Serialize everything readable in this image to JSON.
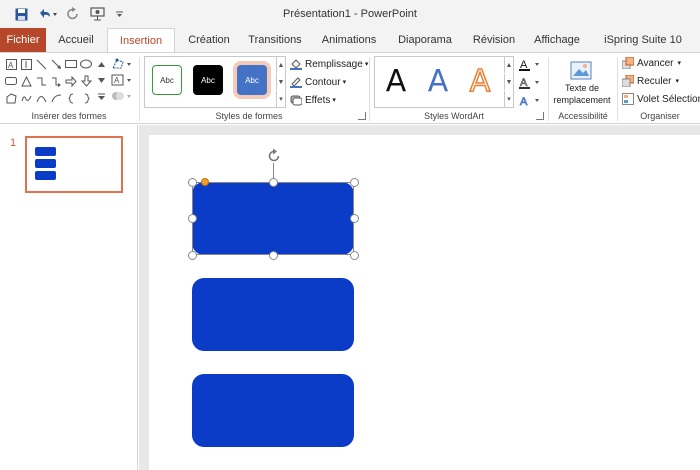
{
  "window": {
    "title": "Présentation1  -  PowerPoint"
  },
  "quick_access": {
    "save_icon": "save-icon",
    "undo_icon": "undo-icon",
    "redo_icon": "redo-icon",
    "present_icon": "present-from-start-icon",
    "customize_icon": "customize-toolbar-icon"
  },
  "tabs": [
    {
      "label": "Fichier"
    },
    {
      "label": "Accueil"
    },
    {
      "label": "Insertion"
    },
    {
      "label": "Création"
    },
    {
      "label": "Transitions"
    },
    {
      "label": "Animations"
    },
    {
      "label": "Diaporama"
    },
    {
      "label": "Révision"
    },
    {
      "label": "Affichage"
    },
    {
      "label": "iSpring Suite 10"
    }
  ],
  "ribbon": {
    "insert_shapes": {
      "label": "Insérer des formes"
    },
    "shape_styles": {
      "label": "Styles de formes",
      "items": [
        {
          "text": "Abc"
        },
        {
          "text": "Abc"
        },
        {
          "text": "Abc"
        }
      ],
      "fill": "Remplissage",
      "outline": "Contour",
      "effects": "Effets"
    },
    "wordart": {
      "label": "Styles WordArt",
      "letters": [
        "A",
        "A",
        "A"
      ]
    },
    "accessibility": {
      "label": "Accessibilité",
      "alt_text_line1": "Texte de",
      "alt_text_line2": "remplacement"
    },
    "arrange": {
      "label": "Organiser",
      "forward": "Avancer",
      "backward": "Reculer",
      "selection_pane": "Volet Sélection"
    }
  },
  "thumbnails": {
    "slide_number": "1"
  },
  "colors": {
    "accent": "#b7472a",
    "shape_fill": "#0a3cc8"
  }
}
